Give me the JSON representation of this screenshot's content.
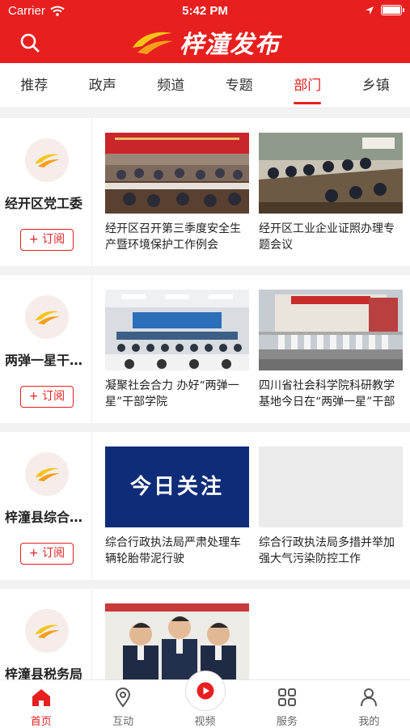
{
  "status": {
    "carrier": "Carrier",
    "time": "5:42 PM"
  },
  "header": {
    "title": "梓潼发布"
  },
  "tabs": [
    {
      "label": "推荐"
    },
    {
      "label": "政声"
    },
    {
      "label": "频道"
    },
    {
      "label": "专题"
    },
    {
      "label": "部门",
      "active": true
    },
    {
      "label": "乡镇"
    }
  ],
  "subscribe_label": "+ 订阅",
  "cards": [
    {
      "department": "经开区党工委",
      "articles": [
        {
          "caption": "经开区召开第三季度安全生产暨环境保护工作例会",
          "banner": "经开区召开第三季度安全生产暨环境保护工作例会"
        },
        {
          "caption": "经开区工业企业证照办理专题会议"
        }
      ]
    },
    {
      "department": "两弹一星干部学院",
      "articles": [
        {
          "caption": "凝聚社会合力 办好“两弹一星”干部学院"
        },
        {
          "caption": "四川省社会科学院科研教学基地今日在“两弹一星”干部学院揭牌"
        }
      ]
    },
    {
      "department": "梓潼县综合行政执法局",
      "articles": [
        {
          "caption": "综合行政执法局严肃处理车辆轮胎带泥行驶",
          "image_text": "今日关注"
        },
        {
          "caption": "综合行政执法局多措并举加强大气污染防控工作"
        }
      ]
    },
    {
      "department": "梓潼县税务局",
      "articles": []
    }
  ],
  "bottom_nav": [
    {
      "label": "首页",
      "icon": "home-icon",
      "active": true
    },
    {
      "label": "互动",
      "icon": "location-pin-icon"
    },
    {
      "label": "视频",
      "icon": "play-icon"
    },
    {
      "label": "服务",
      "icon": "grid-icon"
    },
    {
      "label": "我的",
      "icon": "user-icon"
    }
  ],
  "colors": {
    "brand": "#e81f1f",
    "accent": "#f5a623"
  }
}
